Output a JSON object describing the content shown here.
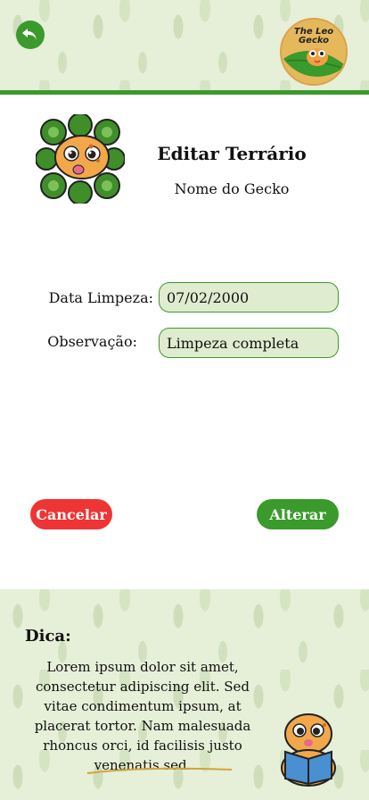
{
  "header": {
    "back_icon": "undo-arrow-icon",
    "logo_text_line1": "The Leo",
    "logo_text_line2": "Gecko"
  },
  "profile": {
    "title": "Editar Terrário",
    "subtitle": "Nome do Gecko"
  },
  "form": {
    "date_label": "Data Limpeza:",
    "date_value": "07/02/2000",
    "obs_label": "Observação:",
    "obs_value": "Limpeza completa"
  },
  "actions": {
    "cancel_label": "Cancelar",
    "save_label": "Alterar"
  },
  "tip": {
    "title": "Dica:",
    "text": "Lorem ipsum dolor sit amet, consectetur adipiscing elit. Sed vitae condimentum ipsum, at placerat tortor. Nam malesuada rhoncus orci, id facilisis justo venenatis sed."
  },
  "colors": {
    "accent_green": "#3a9a2c",
    "cancel_red": "#ee3434",
    "field_bg": "#dfeccf",
    "leafy_bg": "#e6efd8"
  }
}
